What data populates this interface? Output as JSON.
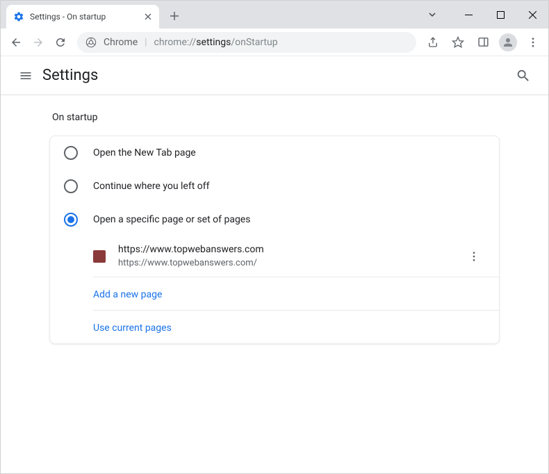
{
  "tab": {
    "title": "Settings - On startup"
  },
  "omnibox": {
    "label": "Chrome",
    "url_prefix": "chrome://",
    "url_bold": "settings",
    "url_suffix": "/onStartup"
  },
  "header": {
    "title": "Settings"
  },
  "section": {
    "label": "On startup",
    "options": [
      {
        "label": "Open the New Tab page",
        "selected": false
      },
      {
        "label": "Continue where you left off",
        "selected": false
      },
      {
        "label": "Open a specific page or set of pages",
        "selected": true
      }
    ],
    "pages": [
      {
        "title": "https://www.topwebanswers.com",
        "url": "https://www.topwebanswers.com/"
      }
    ],
    "add_link": "Add a new page",
    "use_current": "Use current pages"
  }
}
